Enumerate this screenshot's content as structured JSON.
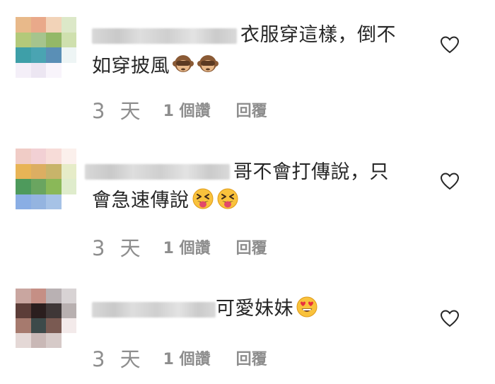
{
  "comments": [
    {
      "text_line1": "衣服穿這樣，倒不",
      "text_line2": "如穿披風",
      "emoji": [
        "see-no-evil-monkey-emoji",
        "see-no-evil-monkey-emoji"
      ],
      "time": "3 天",
      "likes": "1 個讚",
      "reply": "回覆"
    },
    {
      "text_line1": "哥不會打傳說，只",
      "text_line2": "會急速傳說",
      "emoji": [
        "squinting-tongue-face-emoji",
        "squinting-tongue-face-emoji"
      ],
      "time": "3 天",
      "likes": "1 個讚",
      "reply": "回覆"
    },
    {
      "text_line1": "可愛妹妹",
      "text_line2": "",
      "emoji": [
        "heart-eyes-face-emoji"
      ],
      "time": "3 天",
      "likes": "1 個讚",
      "reply": "回覆"
    }
  ],
  "icons": {
    "like": "heart-outline-icon"
  },
  "colors": {
    "text": "#262626",
    "secondary": "#8e8e8e",
    "background": "#ffffff"
  }
}
